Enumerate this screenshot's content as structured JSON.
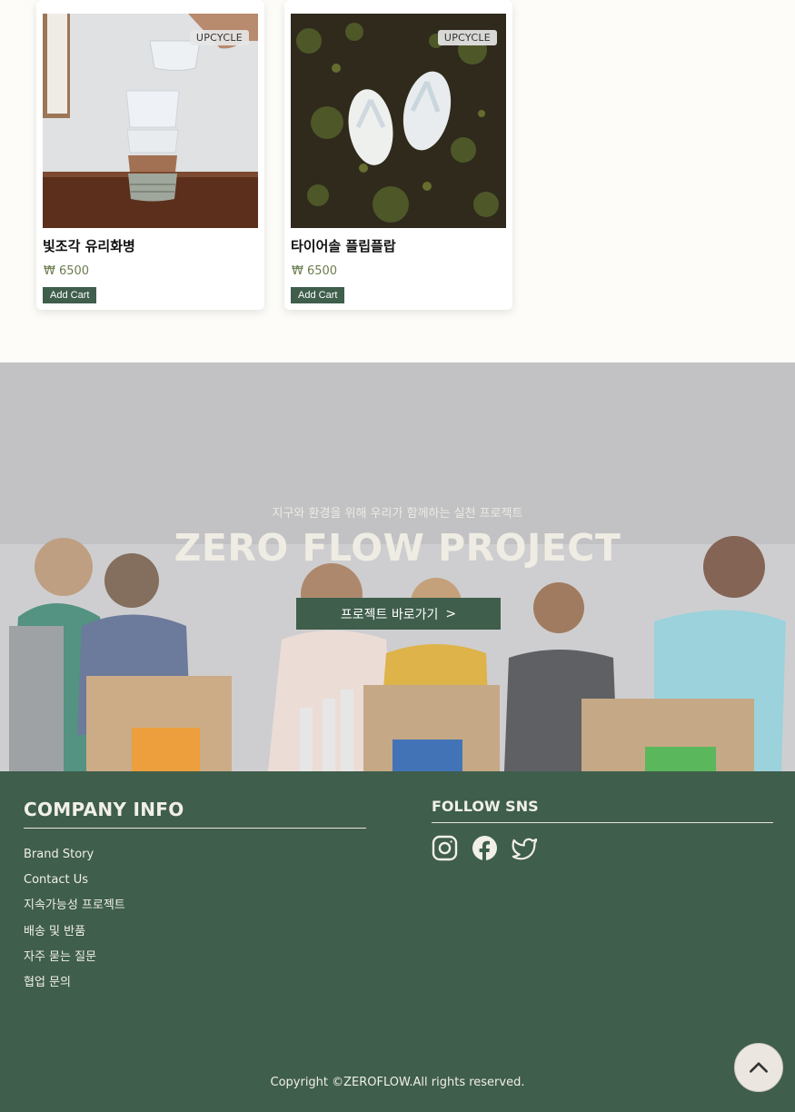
{
  "products": [
    {
      "badge": "UPCYCLE",
      "name": "빛조각 유리화병",
      "price": "₩ 6500",
      "cart_label": "Add Cart"
    },
    {
      "badge": "UPCYCLE",
      "name": "타이어솔 플립플랍",
      "price": "₩ 6500",
      "cart_label": "Add Cart"
    }
  ],
  "banner": {
    "subtitle": "지구와 환경을 위해 우리가 함께하는 실천 프로젝트",
    "title": "ZERO FLOW PROJECT",
    "button_label": "프로젝트 바로가기",
    "button_arrow": ">"
  },
  "footer": {
    "company_heading": "COMPANY INFO",
    "links": [
      "Brand Story",
      "Contact Us",
      "지속가능성 프로젝트",
      "배송 및 반품",
      "자주 묻는 질문",
      "협업 문의"
    ],
    "sns_heading": "FOLLOW SNS",
    "sns_icons": [
      "instagram-icon",
      "facebook-icon",
      "twitter-icon"
    ],
    "copyright": "Copyright ©ZEROFLOW.All rights reserved."
  },
  "colors": {
    "accent": "#3f5e4c",
    "price": "#6b7d4f",
    "background": "#fdfcf8"
  }
}
